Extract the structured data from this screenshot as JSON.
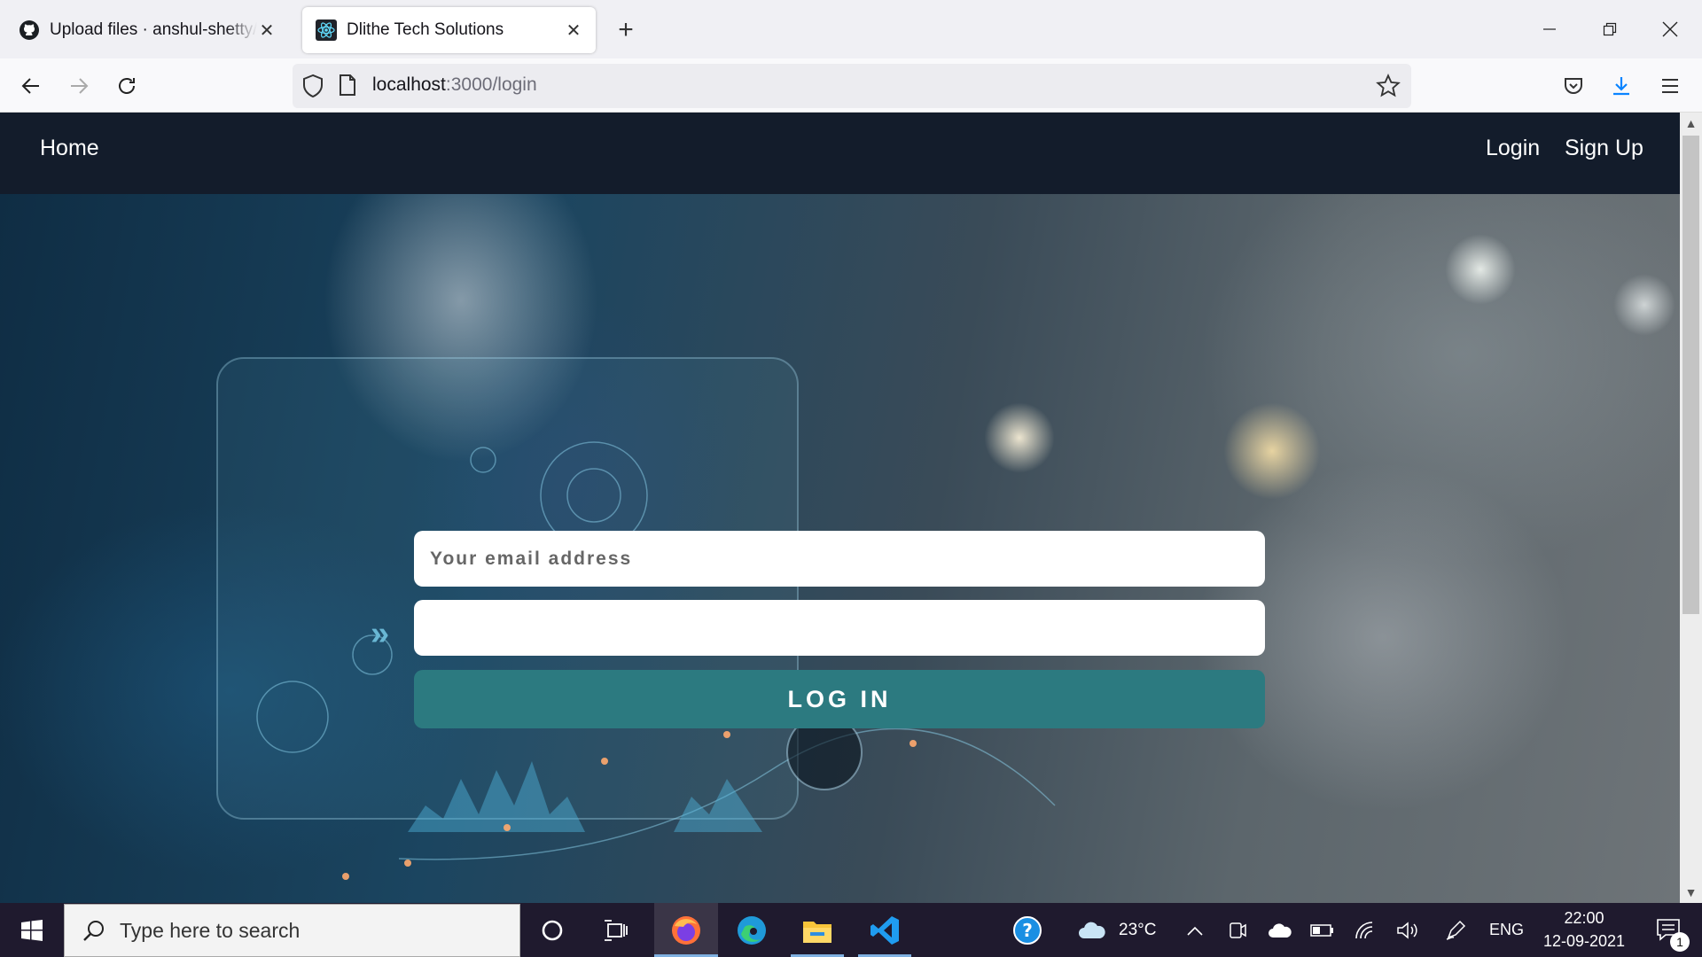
{
  "browser": {
    "tabs": [
      {
        "title": "Upload files · anshul-shetty/Dlithe",
        "icon": "github-icon",
        "active": false
      },
      {
        "title": "Dlithe Tech Solutions",
        "icon": "react-icon",
        "active": true
      }
    ],
    "url_host": "localhost",
    "url_path": ":3000/login"
  },
  "page": {
    "nav": {
      "home": "Home",
      "login": "Login",
      "signup": "Sign Up"
    },
    "form": {
      "email_placeholder": "Your email address",
      "password_value": "",
      "login_label": "LOG IN"
    },
    "accent_color": "#2c7a80",
    "nav_bg": "#131c2b"
  },
  "taskbar": {
    "search_placeholder": "Type here to search",
    "weather": "23°C",
    "language": "ENG",
    "time": "22:00",
    "date": "12-09-2021",
    "notification_count": "1"
  }
}
